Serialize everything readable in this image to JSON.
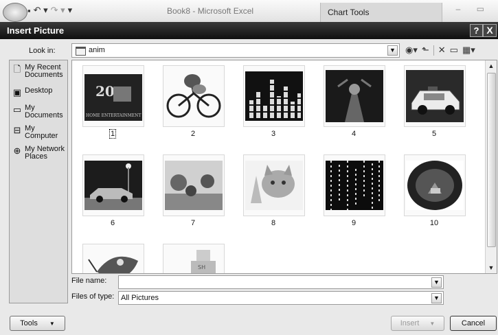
{
  "excel": {
    "title": "Book8 - Microsoft Excel",
    "context_tab": "Chart Tools",
    "window_buttons": "– ▭"
  },
  "dialog": {
    "title": "Insert Picture",
    "help": "?",
    "close": "X"
  },
  "lookin": {
    "label": "Look in:",
    "value": "anim"
  },
  "places": [
    {
      "label": "My Recent Documents",
      "icon": "recent-documents-icon"
    },
    {
      "label": "Desktop",
      "icon": "desktop-icon"
    },
    {
      "label": "My Documents",
      "icon": "my-documents-icon"
    },
    {
      "label": "My Computer",
      "icon": "my-computer-icon"
    },
    {
      "label": "My Network Places",
      "icon": "network-places-icon"
    }
  ],
  "files": [
    {
      "name": "1",
      "icon": "fox-logo-thumbnail"
    },
    {
      "name": "2",
      "icon": "cyclist-thumbnail"
    },
    {
      "name": "3",
      "icon": "equalizer-thumbnail"
    },
    {
      "name": "4",
      "icon": "dark-scene-thumbnail"
    },
    {
      "name": "5",
      "icon": "police-car-thumbnail"
    },
    {
      "name": "6",
      "icon": "car-night-thumbnail"
    },
    {
      "name": "7",
      "icon": "garden-thumbnail"
    },
    {
      "name": "8",
      "icon": "kitten-thumbnail"
    },
    {
      "name": "9",
      "icon": "matrix-code-thumbnail"
    },
    {
      "name": "10",
      "icon": "tunnel-car-thumbnail"
    },
    {
      "name": "",
      "icon": "butterfly-thumbnail"
    },
    {
      "name": "",
      "icon": "building-thumbnail"
    }
  ],
  "selected_file": "1",
  "file_name": {
    "label": "File name:",
    "value": ""
  },
  "file_type": {
    "label": "Files of type:",
    "value": "All Pictures"
  },
  "buttons": {
    "tools": "Tools",
    "insert": "Insert",
    "cancel": "Cancel"
  }
}
